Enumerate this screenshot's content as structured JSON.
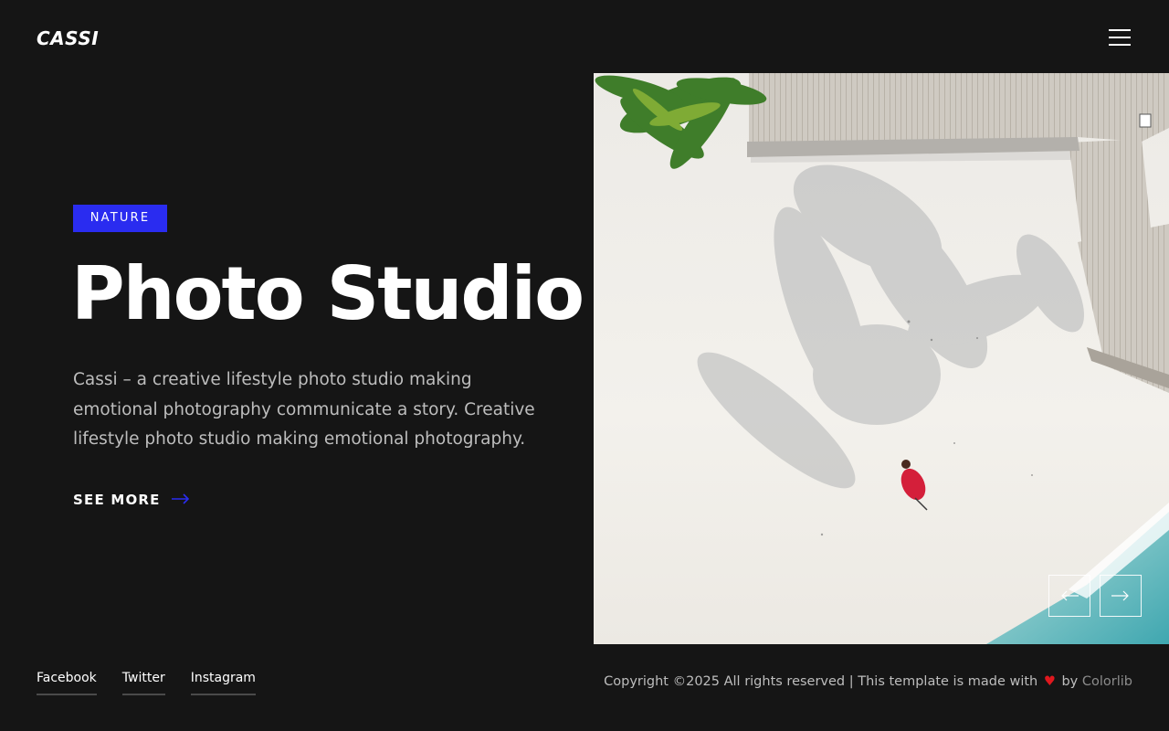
{
  "brand": {
    "logo_text": "CASSI"
  },
  "header": {
    "menu_icon": "hamburger-menu-icon"
  },
  "hero": {
    "tag": "NATURE",
    "title": "Photo Studio",
    "description": "Cassi – a creative lifestyle photo studio making emotional photography communicate a story. Creative lifestyle photo studio making emotional photography.",
    "cta_label": "SEE MORE",
    "cta_icon": "arrow-right-icon",
    "image_subject": "aerial-beach-photo"
  },
  "slider": {
    "prev_icon": "arrow-left-icon",
    "next_icon": "arrow-right-icon"
  },
  "footer": {
    "social": [
      {
        "label": "Facebook"
      },
      {
        "label": "Twitter"
      },
      {
        "label": "Instagram"
      }
    ],
    "copyright_prefix": "Copyright ©2025 All rights reserved | This template is made with",
    "heart_icon": "heart-icon",
    "by_text": "by",
    "credit_link": "Colorlib"
  },
  "colors": {
    "background": "#151515",
    "accent": "#2a2cf0",
    "heart": "#e0181e",
    "text_muted": "#bdbdbd"
  }
}
